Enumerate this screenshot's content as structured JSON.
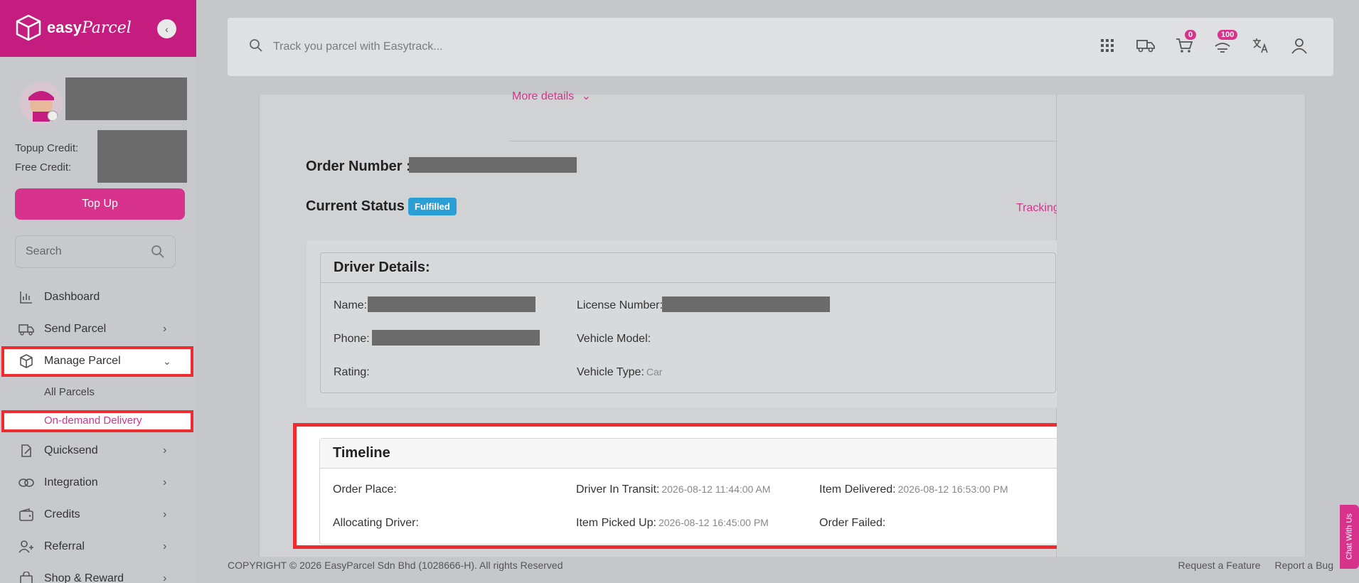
{
  "brand": {
    "name": "easy",
    "name_script": "Parcel"
  },
  "sidebar": {
    "credits": {
      "topup_label": "Topup Credit:",
      "free_label": "Free Credit:"
    },
    "topup_button": "Top Up",
    "search_placeholder": "Search",
    "items": [
      {
        "label": "Dashboard",
        "icon": "chart-icon"
      },
      {
        "label": "Send Parcel",
        "icon": "truck-icon"
      },
      {
        "label": "Manage Parcel",
        "icon": "box-icon"
      },
      {
        "label": "Quicksend",
        "icon": "edit-icon"
      },
      {
        "label": "Integration",
        "icon": "link-icon"
      },
      {
        "label": "Credits",
        "icon": "wallet-icon"
      },
      {
        "label": "Referral",
        "icon": "user-plus-icon"
      },
      {
        "label": "Shop & Reward",
        "icon": "bag-icon"
      }
    ],
    "sub_items": [
      "All Parcels",
      "On-demand Delivery"
    ]
  },
  "header": {
    "search_placeholder": "Track you parcel with Easytrack...",
    "cart_count": "0",
    "notification_count": "100"
  },
  "order": {
    "more_details": "More details",
    "order_number_label": "Order Number :",
    "status_label": "Current Status :",
    "status_value": "Fulfilled",
    "tracking_link": "Tracking"
  },
  "driver": {
    "title": "Driver Details:",
    "name_label": "Name:",
    "license_label": "License Number:",
    "phone_label": "Phone:",
    "vehicle_model_label": "Vehicle Model:",
    "rating_label": "Rating:",
    "vehicle_type_label": "Vehicle Type:",
    "vehicle_type_value": "Car"
  },
  "timeline": {
    "title": "Timeline",
    "order_place_label": "Order Place:",
    "allocating_label": "Allocating Driver:",
    "in_transit_label": "Driver In Transit:",
    "in_transit_value": "2026-08-12 11:44:00 AM",
    "picked_up_label": "Item Picked Up:",
    "picked_up_value": "2026-08-12 16:45:00 PM",
    "delivered_label": "Item Delivered:",
    "delivered_value": "2026-08-12 16:53:00 PM",
    "failed_label": "Order Failed:"
  },
  "footer": {
    "copyright": "COPYRIGHT © 2026 EasyParcel Sdn Bhd (1028666-H). All rights Reserved",
    "request_feature": "Request a Feature",
    "report_bug": "Report a Bug"
  },
  "chat_tab": "Chat With Us"
}
